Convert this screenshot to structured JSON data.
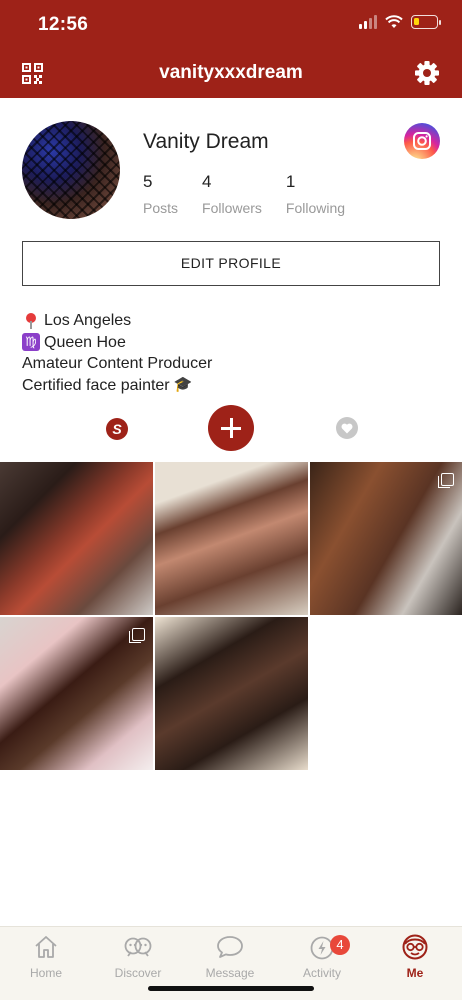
{
  "status_bar": {
    "time": "12:56",
    "battery_level": 0.25,
    "icons": [
      "signal-icon",
      "wifi-icon",
      "battery-icon"
    ]
  },
  "nav": {
    "title": "vanityxxxdream",
    "left_icon": "qr-code-icon",
    "right_icon": "gear-icon"
  },
  "profile": {
    "display_name": "Vanity Dream",
    "stats": [
      {
        "value": "5",
        "label": "Posts"
      },
      {
        "value": "4",
        "label": "Followers"
      },
      {
        "value": "1",
        "label": "Following"
      }
    ],
    "edit_button": "EDIT PROFILE",
    "bio": [
      {
        "emoji": "pin-icon",
        "text": "Los Angeles"
      },
      {
        "emoji": "virgo-icon",
        "text": "Queen Hoe"
      },
      {
        "emoji": "",
        "text": "Amateur Content Producer"
      },
      {
        "emoji": "graduate-icon",
        "text": "Certified face painter"
      }
    ]
  },
  "tabs": {
    "posts_tab_glyph": "S",
    "add_icon": "plus-icon",
    "liked_icon": "heart-icon"
  },
  "grid": {
    "posts": [
      {
        "multi": false
      },
      {
        "multi": false
      },
      {
        "multi": true
      },
      {
        "multi": true
      },
      {
        "multi": false
      }
    ]
  },
  "bottom_nav": {
    "items": [
      {
        "label": "Home",
        "icon": "home-icon",
        "active": false
      },
      {
        "label": "Discover",
        "icon": "discover-icon",
        "active": false
      },
      {
        "label": "Message",
        "icon": "message-icon",
        "active": false
      },
      {
        "label": "Activity",
        "icon": "activity-icon",
        "active": false,
        "badge": "4"
      },
      {
        "label": "Me",
        "icon": "me-icon",
        "active": true
      }
    ]
  },
  "colors": {
    "brand": "#9e2218",
    "badge": "#e8483a",
    "muted": "#a9a9a9"
  }
}
